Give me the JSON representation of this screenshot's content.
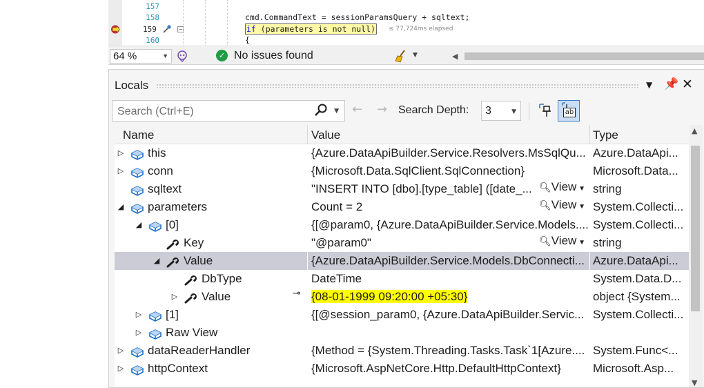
{
  "editor": {
    "lines": [
      {
        "num": "157",
        "code": ""
      },
      {
        "num": "158",
        "code": "cmd.CommandText = sessionParamsQuery + sqltext;"
      },
      {
        "num": "159",
        "code_kw": "if",
        "code_rest": " (parameters is not null)"
      },
      {
        "num": "160",
        "code": "{"
      }
    ],
    "elapsed": "≤ 77,724ms elapsed"
  },
  "statusbar": {
    "zoom": "64 %",
    "issues": "No issues found"
  },
  "locals": {
    "title": "Locals",
    "search_placeholder": "Search (Ctrl+E)",
    "search_depth_label": "Search Depth:",
    "search_depth_value": "3",
    "columns": {
      "name": "Name",
      "value": "Value",
      "type": "Type"
    },
    "view_label": "View",
    "rows": [
      {
        "name": "this",
        "value": "{Azure.DataApiBuilder.Service.Resolvers.MsSqlQu...",
        "type": "Azure.DataApi...",
        "indent": 0,
        "expander": "right",
        "icon": "object-cube-icon",
        "view": false
      },
      {
        "name": "conn",
        "value": "{Microsoft.Data.SqlClient.SqlConnection}",
        "type": "Microsoft.Data...",
        "indent": 0,
        "expander": "right",
        "icon": "object-cube-icon",
        "view": false
      },
      {
        "name": "sqltext",
        "value": "\"INSERT INTO [dbo].[type_table] ([date_...",
        "type": "string",
        "indent": 0,
        "expander": "none",
        "icon": "object-cube-icon",
        "view": true
      },
      {
        "name": "parameters",
        "value": "Count = 2",
        "type": "System.Collecti...",
        "indent": 0,
        "expander": "down",
        "icon": "object-cube-icon",
        "view": true
      },
      {
        "name": "[0]",
        "value": "{[@param0, {Azure.DataApiBuilder.Service.Models....",
        "type": "System.Collecti...",
        "indent": 1,
        "expander": "down",
        "icon": "object-cube-icon",
        "view": false
      },
      {
        "name": "Key",
        "value": "\"@param0\"",
        "type": "string",
        "indent": 2,
        "expander": "none",
        "icon": "wrench-icon",
        "view": true
      },
      {
        "name": "Value",
        "value": "{Azure.DataApiBuilder.Service.Models.DbConnecti...",
        "type": "Azure.DataApi...",
        "indent": 2,
        "expander": "down",
        "icon": "wrench-icon",
        "view": false,
        "selected": true
      },
      {
        "name": "DbType",
        "value": "DateTime",
        "type": "System.Data.D...",
        "indent": 3,
        "expander": "none",
        "icon": "wrench-icon",
        "view": false
      },
      {
        "name": "Value",
        "value": "{08-01-1999 09:20:00 +05:30}",
        "type": "object {System...",
        "indent": 3,
        "expander": "right",
        "icon": "wrench-icon",
        "view": false,
        "highlight": true,
        "pinnable": true
      },
      {
        "name": "[1]",
        "value": "{[@session_param0, {Azure.DataApiBuilder.Servic...",
        "type": "System.Collecti...",
        "indent": 1,
        "expander": "right",
        "icon": "object-cube-icon",
        "view": false
      },
      {
        "name": "Raw View",
        "value": "",
        "type": "",
        "indent": 1,
        "expander": "right",
        "icon": "object-cube-icon",
        "view": false
      },
      {
        "name": "dataReaderHandler",
        "value": "{Method = {System.Threading.Tasks.Task`1[Azure....",
        "type": "System.Func<...",
        "indent": 0,
        "expander": "right",
        "icon": "object-cube-icon",
        "view": false
      },
      {
        "name": "httpContext",
        "value": "{Microsoft.AspNetCore.Http.DefaultHttpContext}",
        "type": "Microsoft.Asp...",
        "indent": 0,
        "expander": "right",
        "icon": "object-cube-icon",
        "view": false
      }
    ]
  }
}
